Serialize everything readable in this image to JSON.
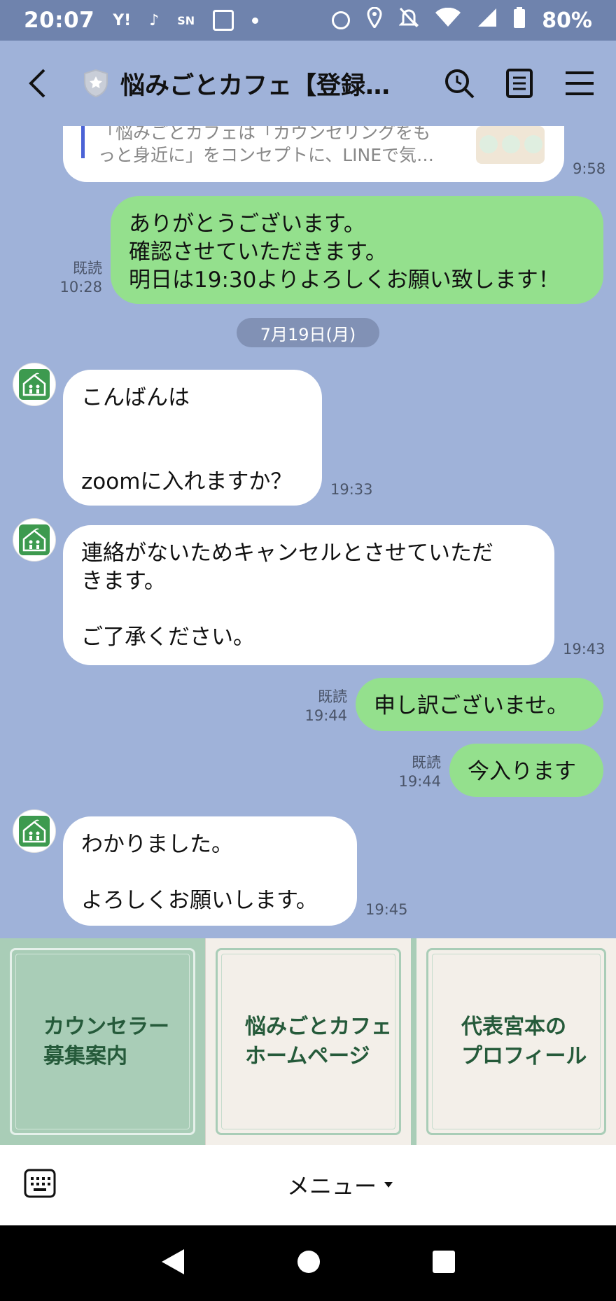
{
  "status_bar": {
    "time": "20:07",
    "battery": "80%",
    "icons": [
      "yahoo-icon",
      "tiktok-icon",
      "smartnews-icon",
      "news-icon",
      "dot-icon",
      "alarm-icon",
      "location-icon",
      "mute-icon",
      "wifi-icon",
      "signal-icon",
      "battery-icon"
    ]
  },
  "header": {
    "title": "悩みごとカフェ【登録…"
  },
  "prev_message": {
    "text": "「悩みごとカフェは「カウンセリングをも\nっと身近に」をコンセプトに、LINEで気…",
    "time": "9:58"
  },
  "messages": [
    {
      "side": "right",
      "text": "ありがとうございます。\n確認させていただきます。\n明日は19:30よりよろしくお願い致します！",
      "read": "既読",
      "time": "10:28"
    },
    {
      "side": "left",
      "text": "こんばんは\n\n\nzoomに入れますか？",
      "time": "19:33"
    },
    {
      "side": "left",
      "text": "連絡がないためキャンセルとさせていただ\nきます。\n\nご了承ください。",
      "time": "19:43"
    },
    {
      "side": "right",
      "text": "申し訳ございませ。",
      "read": "既読",
      "time": "19:44"
    },
    {
      "side": "right",
      "text": "今入ります",
      "read": "既読",
      "time": "19:44"
    },
    {
      "side": "left",
      "text": "わかりました。\n\nよろしくお願いします。",
      "time": "19:45"
    }
  ],
  "date_separator": "7月19日(月)",
  "rich_menu": [
    {
      "label": "カウンセラー\n募集案内",
      "bg": "#a9cdb7"
    },
    {
      "label": "悩みごとカフェ\nホームページ",
      "bg": "#f3efe9"
    },
    {
      "label": "代表宮本の\nプロフィール",
      "bg": "#f3efe9"
    }
  ],
  "bottom_bar": {
    "menu_label": "メニュー"
  },
  "colors": {
    "chat_bg": "#9fb2d9",
    "status_bg": "#6f83ad",
    "green_bubble": "#94e08d",
    "rich_menu_green": "#a9cdb7"
  }
}
